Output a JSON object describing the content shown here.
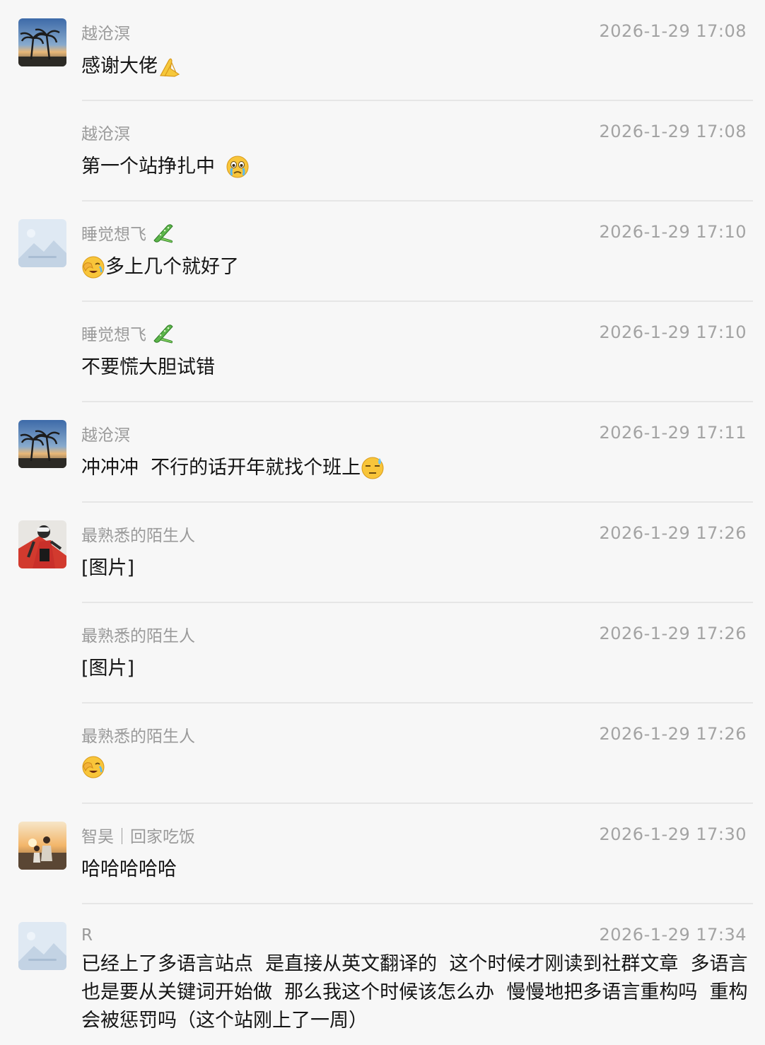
{
  "messages": [
    {
      "sender": "越沧溟",
      "time": "2026-1-29 17:08",
      "text": "感谢大佬",
      "content_emoji": "folded-hands-icon",
      "avatar": "palm-beach"
    },
    {
      "sender": "越沧溟",
      "time": "2026-1-29 17:08",
      "text": "第一个站挣扎中 ",
      "content_emoji": "crying-face-icon",
      "avatar": ""
    },
    {
      "sender": "睡觉想飞",
      "time": "2026-1-29 17:10",
      "name_emoji": "cucumber-icon",
      "text": "多上几个就好了",
      "leading_emoji": "facepalm-icon",
      "avatar": "placeholder-image"
    },
    {
      "sender": "睡觉想飞",
      "time": "2026-1-29 17:10",
      "name_emoji": "cucumber-icon",
      "text": "不要慌大胆试错",
      "avatar": ""
    },
    {
      "sender": "越沧溟",
      "time": "2026-1-29 17:11",
      "text": "冲冲冲  不行的话开年就找个班上",
      "content_emoji": "sweat-face-icon",
      "avatar": "palm-beach"
    },
    {
      "sender": "最熟悉的陌生人",
      "time": "2026-1-29 17:26",
      "text": "[图片]",
      "avatar": "cyclist"
    },
    {
      "sender": "最熟悉的陌生人",
      "time": "2026-1-29 17:26",
      "text": "[图片]",
      "avatar": ""
    },
    {
      "sender": "最熟悉的陌生人",
      "time": "2026-1-29 17:26",
      "text": "",
      "content_emoji": "facepalm-icon",
      "avatar": ""
    },
    {
      "sender": "智昊｜回家吃饭",
      "time": "2026-1-29 17:30",
      "text": "哈哈哈哈哈",
      "avatar": "sunset-family"
    },
    {
      "sender": "R",
      "time": "2026-1-29 17:34",
      "text": "已经上了多语言站点  是直接从英文翻译的  这个时候才刚读到社群文章  多语言也是要从关键词开始做  那么我这个时候该怎么办  慢慢地把多语言重构吗  重构会被惩罚吗（这个站刚上了一周）",
      "avatar": "placeholder-image"
    }
  ]
}
